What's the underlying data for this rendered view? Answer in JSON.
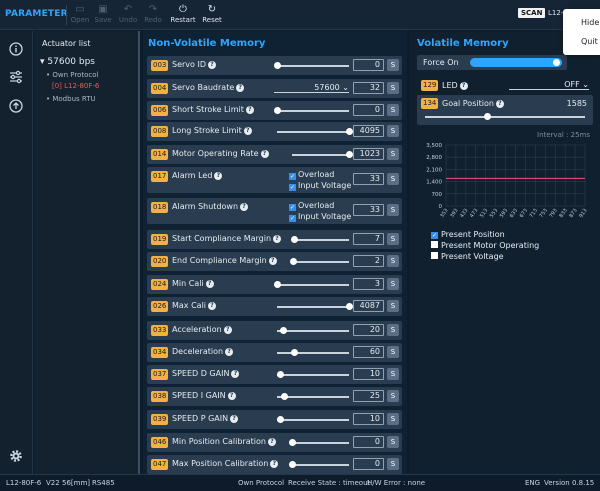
{
  "toolbar": {
    "brand": "PARAMETER",
    "open": "Open",
    "save": "Save",
    "undo": "Undo",
    "redo": "Redo",
    "restart": "Restart",
    "reset": "Reset",
    "scan": "SCAN",
    "port": "L12-"
  },
  "popup": {
    "hide": "Hide",
    "quit": "Quit"
  },
  "tree": {
    "title": "Actuator list",
    "baud": "57600 bps",
    "protocol": "• Own Protocol",
    "device": "[0] L12-80F-6",
    "modbus": "• Modbus RTU"
  },
  "nonvolatile": {
    "title": "Non-Volatile Memory",
    "rows": [
      {
        "addr": "003",
        "name": "Servo ID",
        "value": "0",
        "level": 0.0
      },
      {
        "addr": "004",
        "name": "Servo Baudrate",
        "value": "32",
        "select": "57600"
      },
      {
        "addr": "006",
        "name": "Short Stroke Limit",
        "value": "0",
        "level": 0.0
      },
      {
        "addr": "008",
        "name": "Long Stroke Limit",
        "value": "4095",
        "level": 1.0
      },
      {
        "addr": "014",
        "name": "Motor Operating Rate",
        "value": "1023",
        "level": 1.0
      },
      {
        "addr": "017",
        "name": "Alarm Led",
        "value": "33",
        "checks": [
          "Overload",
          "Input Voltage"
        ]
      },
      {
        "addr": "018",
        "name": "Alarm Shutdown",
        "value": "33",
        "checks": [
          "Overload",
          "Input Voltage"
        ]
      },
      {
        "addr": "019",
        "name": "Start Compliance Margin",
        "value": "7",
        "level": 0.03
      },
      {
        "addr": "020",
        "name": "End Compliance Margin",
        "value": "2",
        "level": 0.01
      },
      {
        "addr": "024",
        "name": "Min Cali",
        "value": "3",
        "level": 0.0
      },
      {
        "addr": "026",
        "name": "Max Cali",
        "value": "4087",
        "level": 1.0
      },
      {
        "addr": "033",
        "name": "Acceleration",
        "value": "20",
        "level": 0.08
      },
      {
        "addr": "034",
        "name": "Deceleration",
        "value": "60",
        "level": 0.24
      },
      {
        "addr": "037",
        "name": "SPEED D GAIN",
        "value": "10",
        "level": 0.04
      },
      {
        "addr": "038",
        "name": "SPEED I GAIN",
        "value": "25",
        "level": 0.1
      },
      {
        "addr": "039",
        "name": "SPEED P GAIN",
        "value": "10",
        "level": 0.04
      },
      {
        "addr": "046",
        "name": "Min Position Calibration",
        "value": "0",
        "level": 0.0
      },
      {
        "addr": "047",
        "name": "Max Position Calibration",
        "value": "0",
        "level": 0.0
      }
    ],
    "save_label": "S"
  },
  "volatile": {
    "title": "Volatile Memory",
    "force_on": "Force On",
    "led": {
      "addr": "129",
      "name": "LED",
      "value": "OFF"
    },
    "goal": {
      "addr": "134",
      "name": "Goal Position",
      "value": "1585",
      "level": 0.39
    },
    "interval": "Interval : 25ms",
    "legend": [
      "Present Position",
      "Present Motor Operating",
      "Present Voltage"
    ]
  },
  "chart_data": {
    "type": "line",
    "y_ticks": [
      "3,500",
      "2,800",
      "2,100",
      "1,400",
      "700",
      "0"
    ],
    "ylim": [
      0,
      3500
    ],
    "x_ticks": [
      "353",
      "393",
      "433",
      "473",
      "513",
      "553",
      "593",
      "633",
      "673",
      "713",
      "753",
      "793",
      "833",
      "873",
      "913"
    ],
    "series": [
      {
        "name": "Present Position",
        "color": "#e8547a",
        "values": [
          1585,
          1585,
          1585,
          1585,
          1585,
          1585,
          1585,
          1585,
          1585,
          1585,
          1585,
          1585,
          1585,
          1585,
          1585
        ]
      }
    ],
    "grid": true
  },
  "status": {
    "model": "L12-80F-6",
    "version": "V22",
    "stroke": "56[mm]",
    "iface": "RS485",
    "protocol": "Own Protocol",
    "receive": "Receive State : timeout",
    "hw": "H/W Error : none",
    "lang": "ENG",
    "appver": "Version 0.8.15"
  },
  "colors": {
    "accent": "#2ea6ff",
    "addr_badge": "#f2b045",
    "line": "#e8547a"
  }
}
